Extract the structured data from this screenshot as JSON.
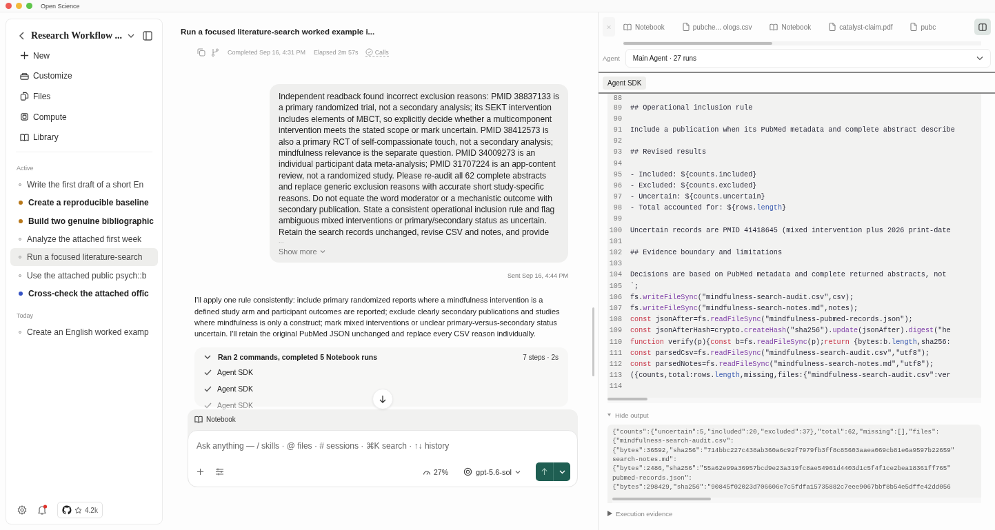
{
  "window": {
    "title": "Open Science"
  },
  "sidebar": {
    "title": "Research Workflow ...",
    "nav": [
      {
        "label": "New",
        "kind": "plus"
      },
      {
        "label": "Customize",
        "kind": "toolbox"
      },
      {
        "label": "Files",
        "kind": "files"
      },
      {
        "label": "Compute",
        "kind": "chip"
      },
      {
        "label": "Library",
        "kind": "book"
      }
    ],
    "groups": [
      {
        "label": "Active",
        "items": [
          {
            "label": "Write the first draft of a short En",
            "unread": false,
            "selected": false
          },
          {
            "label": "Create a reproducible baseline",
            "unread": true,
            "color": "#b8781a",
            "selected": false
          },
          {
            "label": "Build two genuine bibliographic",
            "unread": true,
            "color": "#b8781a",
            "selected": false
          },
          {
            "label": "Analyze the attached first week",
            "unread": false,
            "selected": false
          },
          {
            "label": "Run a focused literature-search",
            "unread": false,
            "selected": true
          },
          {
            "label": "Use the attached public psych::b",
            "unread": false,
            "selected": false
          },
          {
            "label": "Cross-check the attached offic",
            "unread": true,
            "color": "#3553c4",
            "selected": false
          }
        ]
      },
      {
        "label": "Today",
        "items": [
          {
            "label": "Create an English worked examp",
            "unread": false,
            "selected": false
          }
        ]
      }
    ],
    "footer": {
      "notification": true,
      "stars": "4.2k"
    }
  },
  "chat": {
    "title": "Run a focused literature-search worked example i...",
    "completed": "Completed Sep 16, 4:31 PM",
    "elapsed": "Elapsed 2m 57s",
    "calls": "Calls",
    "user_message": "Independent readback found incorrect exclusion reasons: PMID 38837133 is a primary randomized trial, not a secondary analysis; its SEKT intervention includes elements of MBCT, so explicitly decide whether a multicomponent intervention meets the stated scope or mark uncertain. PMID 38412573 is also a primary RCT of self-compassionate touch, not a secondary analysis; mindfulness relevance is the separate question. PMID 34009273 is an individual participant data meta-analysis; PMID 31707224 is an app-content review, not a randomized study. Please re-audit all 62 complete abstracts and replace generic exclusion reasons with accurate short study-specific reasons. Do not equate the word moderator or a mechanistic outcome with secondary publication. State a consistent operational inclusion rule and flag ambiguous mixed interventions or primary/secondary status as uncertain. Retain the search records unchanged, revise CSV and notes, and provide",
    "ellipsis": "...",
    "show_more": "Show more",
    "sent": "Sent Sep 16, 4:44 PM",
    "reply": "I'll apply one rule consistently: include primary randomized reports where a mindfulness intervention is a defined study arm and participant outcomes are reported; exclude clearly secondary publications and studies where mindfulness is only a construct; mark mixed interventions or unclear primary-versus-secondary status uncertain. I'll retain the original PubMed JSON unchanged and replace every CSV reason individually.",
    "steps": {
      "title": "Ran 2 commands, completed 5 Notebook runs",
      "summary": "7 steps · 2s",
      "expanded": true,
      "items": [
        {
          "label": "Agent SDK",
          "done": true
        },
        {
          "label": "Agent SDK",
          "done": true
        },
        {
          "label": "Agent SDK",
          "done": true
        }
      ]
    },
    "composer": {
      "attachment": "Notebook",
      "placeholder": "Ask anything — / skills · @ files · # sessions · ⌘K search · ↑↓ history",
      "context": "27%",
      "model": "gpt-5.6-sol"
    }
  },
  "panel": {
    "tabs": [
      {
        "label": "Notebook",
        "kind": "notebook"
      },
      {
        "label": "pubche... ologs.csv",
        "kind": "file"
      },
      {
        "label": "Notebook",
        "kind": "notebook"
      },
      {
        "label": "catalyst-claim.pdf",
        "kind": "file"
      },
      {
        "label": "pubc",
        "kind": "file"
      }
    ],
    "agent_label": "Agent",
    "agent": "Main Agent · 27 runs",
    "chip": "Agent SDK",
    "code": [
      {
        "n": "88"
      },
      {
        "n": "89",
        "segments": [
          {
            "text": "## Operational inclusion rule",
            "kind": "plain"
          }
        ]
      },
      {
        "n": "90"
      },
      {
        "n": "91",
        "segments": [
          {
            "text": "Include a publication when its PubMed metadata and complete abstract describe",
            "kind": "plain"
          }
        ]
      },
      {
        "n": "92"
      },
      {
        "n": "93",
        "segments": [
          {
            "text": "## Revised results",
            "kind": "plain"
          }
        ]
      },
      {
        "n": "94"
      },
      {
        "n": "95",
        "segments": [
          {
            "text": "- Included: ${counts.included}",
            "kind": "plain"
          }
        ]
      },
      {
        "n": "96",
        "segments": [
          {
            "text": "- Excluded: ${counts.excluded}",
            "kind": "plain"
          }
        ]
      },
      {
        "n": "97",
        "segments": [
          {
            "text": "- Uncertain: ${counts.uncertain}",
            "kind": "plain"
          }
        ]
      },
      {
        "n": "98",
        "segments": [
          {
            "text": "- Total accounted for: ${rows.",
            "kind": "plain"
          },
          {
            "text": "length",
            "kind": "prop"
          },
          {
            "text": "}",
            "kind": "plain"
          }
        ]
      },
      {
        "n": "99"
      },
      {
        "n": "100",
        "segments": [
          {
            "text": "Uncertain records are PMID 41418645 (mixed intervention plus 2026 print-date",
            "kind": "plain"
          }
        ]
      },
      {
        "n": "101"
      },
      {
        "n": "102",
        "segments": [
          {
            "text": "## Evidence boundary and limitations",
            "kind": "plain"
          }
        ]
      },
      {
        "n": "103"
      },
      {
        "n": "104",
        "segments": [
          {
            "text": "Decisions are based on PubMed metadata and complete returned abstracts, not",
            "kind": "plain"
          }
        ]
      },
      {
        "n": "105",
        "segments": [
          {
            "text": "`;",
            "kind": "plain"
          }
        ]
      },
      {
        "n": "106",
        "segments": [
          {
            "text": "fs.",
            "kind": "plain"
          },
          {
            "text": "writeFileSync",
            "kind": "func"
          },
          {
            "text": "(\"mindfulness-search-audit.csv\",csv);",
            "kind": "plain"
          }
        ]
      },
      {
        "n": "107",
        "segments": [
          {
            "text": "fs.",
            "kind": "plain"
          },
          {
            "text": "writeFileSync",
            "kind": "func"
          },
          {
            "text": "(\"mindfulness-search-notes.md\",notes);",
            "kind": "plain"
          }
        ]
      },
      {
        "n": "108",
        "segments": [
          {
            "text": "const",
            "kind": "keyword"
          },
          {
            "text": " jsonAfter=fs.",
            "kind": "plain"
          },
          {
            "text": "readFileSync",
            "kind": "func"
          },
          {
            "text": "(\"mindfulness-pubmed-records.json\");",
            "kind": "plain"
          }
        ]
      },
      {
        "n": "109",
        "segments": [
          {
            "text": "const",
            "kind": "keyword"
          },
          {
            "text": " jsonAfterHash=crypto.",
            "kind": "plain"
          },
          {
            "text": "createHash",
            "kind": "func"
          },
          {
            "text": "(\"sha256\").",
            "kind": "plain"
          },
          {
            "text": "update",
            "kind": "func"
          },
          {
            "text": "(jsonAfter).",
            "kind": "plain"
          },
          {
            "text": "digest",
            "kind": "func"
          },
          {
            "text": "(\"he",
            "kind": "plain"
          }
        ]
      },
      {
        "n": "110",
        "segments": [
          {
            "text": "function",
            "kind": "keyword"
          },
          {
            "text": " verify(p){",
            "kind": "plain"
          },
          {
            "text": "const",
            "kind": "keyword"
          },
          {
            "text": " b=fs.",
            "kind": "plain"
          },
          {
            "text": "readFileSync",
            "kind": "func"
          },
          {
            "text": "(p);",
            "kind": "plain"
          },
          {
            "text": "return",
            "kind": "keyword"
          },
          {
            "text": " {bytes:b.",
            "kind": "plain"
          },
          {
            "text": "length",
            "kind": "prop"
          },
          {
            "text": ",sha256:",
            "kind": "plain"
          }
        ]
      },
      {
        "n": "111",
        "segments": [
          {
            "text": "const",
            "kind": "keyword"
          },
          {
            "text": " parsedCsv=fs.",
            "kind": "plain"
          },
          {
            "text": "readFileSync",
            "kind": "func"
          },
          {
            "text": "(\"mindfulness-search-audit.csv\",\"utf8\");",
            "kind": "plain"
          }
        ]
      },
      {
        "n": "112",
        "segments": [
          {
            "text": "const",
            "kind": "keyword"
          },
          {
            "text": " parsedNotes=fs.",
            "kind": "plain"
          },
          {
            "text": "readFileSync",
            "kind": "func"
          },
          {
            "text": "(\"mindfulness-search-notes.md\",\"utf8\");",
            "kind": "plain"
          }
        ]
      },
      {
        "n": "113",
        "segments": [
          {
            "text": "({counts,total:rows.",
            "kind": "plain"
          },
          {
            "text": "length",
            "kind": "prop"
          },
          {
            "text": ",missing,files:{\"mindfulness-search-audit.csv\":ver",
            "kind": "plain"
          }
        ]
      },
      {
        "n": "114"
      }
    ],
    "output_toggle": "Hide output",
    "output": [
      "{\"counts\":{\"uncertain\":5,\"included\":20,\"excluded\":37},\"total\":62,\"missing\":[],\"files\":",
      "{\"mindfulness-search-audit.csv\":",
      "{\"bytes\":36592,\"sha256\":\"714bbc227c438ab360a6c92f7979fb3ff8c85603aaea069cb81e6a9597b22659\"",
      "search-notes.md\":",
      "{\"bytes\":2486,\"sha256\":\"55a62e99a36957bcd9e23a319fc8ae54961d4403d1c5f4f1ce2bea18361ff765\"",
      "pubmed-records.json\":",
      "{\"bytes\":298429,\"sha256\":\"90845f02023d706606e7c5fdfa15735882c7eee9067bbf8b54e5dffe42dd056"
    ],
    "evidence": "Execution evidence"
  }
}
